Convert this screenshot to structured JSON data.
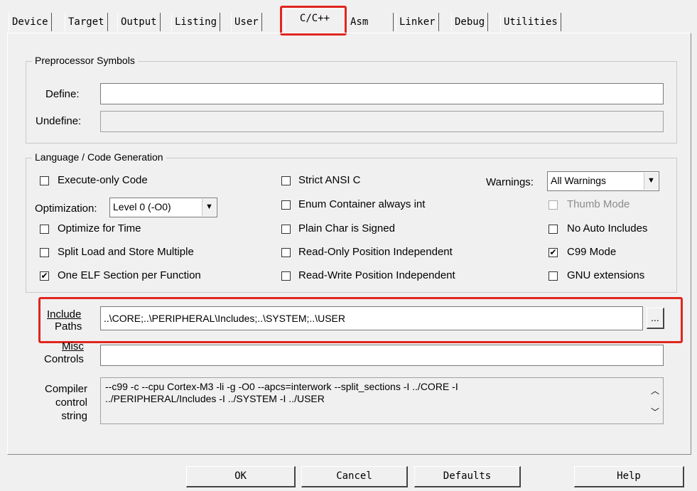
{
  "tabs": [
    "Device",
    "Target",
    "Output",
    "Listing",
    "User",
    "C/C++",
    "Asm",
    "Linker",
    "Debug",
    "Utilities"
  ],
  "active_tab": "C/C++",
  "preprocessor": {
    "legend": "Preprocessor Symbols",
    "define_label": "Define:",
    "define_value": "",
    "undefine_label": "Undefine:",
    "undefine_value": ""
  },
  "language": {
    "legend": "Language / Code Generation",
    "execute_only": "Execute-only Code",
    "optimization_label": "Optimization:",
    "optimization_value": "Level 0 (-O0)",
    "optimize_time": "Optimize for Time",
    "split_load": "Split Load and Store Multiple",
    "one_elf": "One ELF Section per Function",
    "strict_ansi": "Strict ANSI C",
    "enum_container": "Enum Container always int",
    "plain_char": "Plain Char is Signed",
    "ro_pos_indep": "Read-Only Position Independent",
    "rw_pos_indep": "Read-Write Position Independent",
    "warnings_label": "Warnings:",
    "warnings_value": "All Warnings",
    "thumb_mode": "Thumb Mode",
    "no_auto_includes": "No Auto Includes",
    "c99_mode": "C99 Mode",
    "gnu_extensions": "GNU extensions"
  },
  "include": {
    "label_line1": "Include",
    "label_line2": "Paths",
    "value": "..\\CORE;..\\PERIPHERAL\\Includes;..\\SYSTEM;..\\USER",
    "browse": "..."
  },
  "misc": {
    "label_line1": "Misc",
    "label_line2": "Controls",
    "value": ""
  },
  "compiler": {
    "label_line1": "Compiler",
    "label_line2": "control",
    "label_line3": "string",
    "line1": "--c99 -c --cpu Cortex-M3 -li -g -O0 --apcs=interwork --split_sections -I ../CORE -I",
    "line2": "../PERIPHERAL/Includes -I ../SYSTEM -I ../USER"
  },
  "buttons": {
    "ok": "OK",
    "cancel": "Cancel",
    "defaults": "Defaults",
    "help": "Help"
  },
  "highlight_color": "#e0261f"
}
